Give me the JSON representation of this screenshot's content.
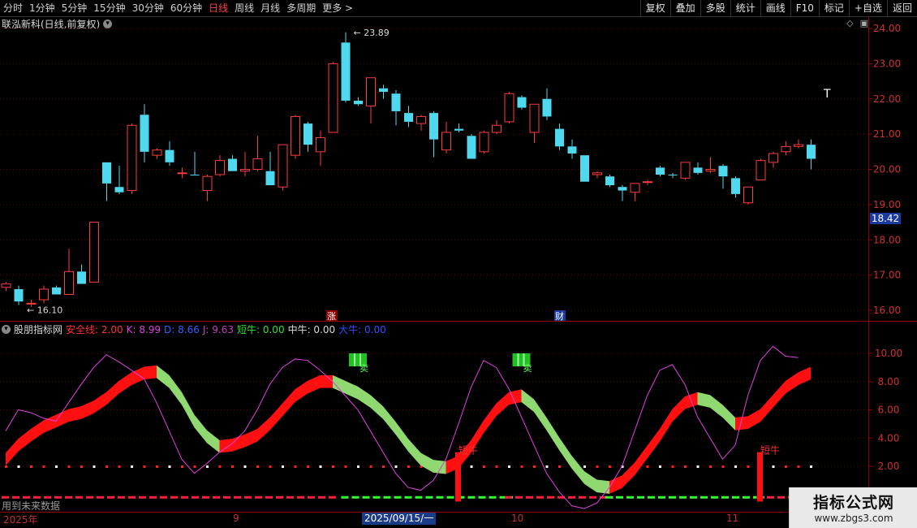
{
  "toolbar": {
    "periods": [
      "分时",
      "1分钟",
      "5分钟",
      "15分钟",
      "30分钟",
      "60分钟",
      "日线",
      "周线",
      "月线",
      "多周期",
      "更多 >"
    ],
    "active_period": "日线",
    "buttons": [
      "复权",
      "叠加",
      "多股",
      "统计",
      "画线",
      "F10",
      "标记",
      "+自选",
      "返回"
    ]
  },
  "stock": {
    "title": "联泓新科(日线,前复权)",
    "settings_icon": "chevron-down-icon",
    "high_label": "23.89",
    "low_label": "16.10",
    "current_price": "18.42",
    "markers": {
      "zhang": "涨",
      "cai": "财"
    }
  },
  "price_axis": {
    "ticks": [
      "24.00",
      "23.00",
      "22.00",
      "21.00",
      "20.00",
      "19.00",
      "18.00",
      "17.00",
      "16.00"
    ]
  },
  "indicator": {
    "name": "股朋指标网",
    "values": [
      {
        "label": "安全线:",
        "value": "2.00",
        "color": "#ff3030"
      },
      {
        "label": "K:",
        "value": "8.99",
        "color": "#e040e0"
      },
      {
        "label": "D:",
        "value": "8.66",
        "color": "#3060ff"
      },
      {
        "label": "J:",
        "value": "9.63",
        "color": "#c040c0"
      },
      {
        "label": "短牛:",
        "value": "0.00",
        "color": "#30e030"
      },
      {
        "label": "中牛:",
        "value": "0.00",
        "color": "#d8d8d8"
      },
      {
        "label": "大牛:",
        "value": "0.00",
        "color": "#3050ff"
      }
    ],
    "axis_ticks": [
      "10.00",
      "8.00",
      "6.00",
      "4.00",
      "2.00"
    ],
    "buy_label": "短牛",
    "sell_label": "卖"
  },
  "date_axis": {
    "labels": [
      "2025年",
      "9",
      "10",
      "11"
    ],
    "highlight": "2025/09/15/一"
  },
  "future_data_text": "用到未来数据",
  "watermark": {
    "title": "指标公式网",
    "url": "www.zbgs3.com"
  },
  "chart_data": {
    "type": "candlestick",
    "ylim": [
      15.8,
      24.3
    ],
    "candles": [
      {
        "o": 16.65,
        "h": 16.8,
        "l": 16.55,
        "c": 16.75,
        "up": true
      },
      {
        "o": 16.6,
        "h": 16.7,
        "l": 16.15,
        "c": 16.25,
        "up": false
      },
      {
        "o": 16.2,
        "h": 16.3,
        "l": 16.1,
        "c": 16.2,
        "up": true
      },
      {
        "o": 16.3,
        "h": 16.7,
        "l": 16.2,
        "c": 16.6,
        "up": true
      },
      {
        "o": 16.65,
        "h": 16.7,
        "l": 16.45,
        "c": 16.45,
        "up": false
      },
      {
        "o": 16.45,
        "h": 17.75,
        "l": 16.45,
        "c": 17.1,
        "up": true
      },
      {
        "o": 17.1,
        "h": 17.3,
        "l": 16.75,
        "c": 16.75,
        "up": false
      },
      {
        "o": 16.8,
        "h": 18.5,
        "l": 16.8,
        "c": 18.5,
        "up": true
      },
      {
        "o": 20.2,
        "h": 20.2,
        "l": 19.1,
        "c": 19.6,
        "up": false
      },
      {
        "o": 19.5,
        "h": 20.1,
        "l": 19.3,
        "c": 19.35,
        "up": false
      },
      {
        "o": 19.4,
        "h": 21.3,
        "l": 19.3,
        "c": 21.25,
        "up": true
      },
      {
        "o": 21.55,
        "h": 21.85,
        "l": 20.2,
        "c": 20.5,
        "up": false
      },
      {
        "o": 20.4,
        "h": 20.6,
        "l": 20.3,
        "c": 20.55,
        "up": true
      },
      {
        "o": 20.55,
        "h": 20.8,
        "l": 20.1,
        "c": 20.2,
        "up": false
      },
      {
        "o": 19.9,
        "h": 20.05,
        "l": 19.75,
        "c": 19.9,
        "up": true
      },
      {
        "o": 19.85,
        "h": 20.5,
        "l": 19.85,
        "c": 19.85,
        "up": false
      },
      {
        "o": 19.4,
        "h": 19.85,
        "l": 19.1,
        "c": 19.8,
        "up": true
      },
      {
        "o": 19.85,
        "h": 20.4,
        "l": 19.8,
        "c": 20.25,
        "up": true
      },
      {
        "o": 20.3,
        "h": 20.4,
        "l": 19.95,
        "c": 19.95,
        "up": false
      },
      {
        "o": 20.0,
        "h": 20.5,
        "l": 19.8,
        "c": 19.95,
        "up": true
      },
      {
        "o": 20.0,
        "h": 20.95,
        "l": 19.95,
        "c": 20.3,
        "up": true
      },
      {
        "o": 19.95,
        "h": 20.5,
        "l": 19.8,
        "c": 19.55,
        "up": false
      },
      {
        "o": 19.5,
        "h": 20.7,
        "l": 19.4,
        "c": 20.7,
        "up": true
      },
      {
        "o": 20.4,
        "h": 21.55,
        "l": 20.3,
        "c": 21.5,
        "up": true
      },
      {
        "o": 21.3,
        "h": 21.35,
        "l": 20.5,
        "c": 20.7,
        "up": false
      },
      {
        "o": 20.5,
        "h": 21.1,
        "l": 20.1,
        "c": 20.9,
        "up": true
      },
      {
        "o": 21.05,
        "h": 23.05,
        "l": 21.05,
        "c": 23.0,
        "up": true
      },
      {
        "o": 23.6,
        "h": 23.89,
        "l": 21.9,
        "c": 21.95,
        "up": false
      },
      {
        "o": 21.95,
        "h": 22.05,
        "l": 21.8,
        "c": 21.85,
        "up": false
      },
      {
        "o": 21.8,
        "h": 22.6,
        "l": 21.3,
        "c": 22.6,
        "up": true
      },
      {
        "o": 22.3,
        "h": 22.4,
        "l": 22.0,
        "c": 22.2,
        "up": false
      },
      {
        "o": 22.15,
        "h": 22.25,
        "l": 21.25,
        "c": 21.65,
        "up": false
      },
      {
        "o": 21.6,
        "h": 21.8,
        "l": 21.2,
        "c": 21.35,
        "up": false
      },
      {
        "o": 21.3,
        "h": 21.55,
        "l": 21.1,
        "c": 21.5,
        "up": true
      },
      {
        "o": 21.6,
        "h": 21.65,
        "l": 20.35,
        "c": 20.85,
        "up": false
      },
      {
        "o": 20.55,
        "h": 21.35,
        "l": 20.45,
        "c": 21.05,
        "up": true
      },
      {
        "o": 21.15,
        "h": 21.3,
        "l": 21.05,
        "c": 21.1,
        "up": false
      },
      {
        "o": 20.95,
        "h": 21.0,
        "l": 20.3,
        "c": 20.3,
        "up": false
      },
      {
        "o": 20.5,
        "h": 21.1,
        "l": 20.45,
        "c": 21.05,
        "up": true
      },
      {
        "o": 21.05,
        "h": 21.4,
        "l": 21.0,
        "c": 21.25,
        "up": true
      },
      {
        "o": 21.35,
        "h": 22.2,
        "l": 21.3,
        "c": 22.15,
        "up": true
      },
      {
        "o": 22.05,
        "h": 22.1,
        "l": 21.7,
        "c": 21.75,
        "up": false
      },
      {
        "o": 21.05,
        "h": 21.85,
        "l": 20.75,
        "c": 21.85,
        "up": true
      },
      {
        "o": 22.0,
        "h": 22.3,
        "l": 21.4,
        "c": 21.5,
        "up": false
      },
      {
        "o": 21.15,
        "h": 21.3,
        "l": 20.55,
        "c": 20.65,
        "up": false
      },
      {
        "o": 20.65,
        "h": 20.85,
        "l": 20.3,
        "c": 20.45,
        "up": false
      },
      {
        "o": 20.4,
        "h": 20.4,
        "l": 19.65,
        "c": 19.65,
        "up": false
      },
      {
        "o": 19.85,
        "h": 19.95,
        "l": 19.75,
        "c": 19.9,
        "up": true
      },
      {
        "o": 19.8,
        "h": 19.85,
        "l": 19.5,
        "c": 19.55,
        "up": false
      },
      {
        "o": 19.5,
        "h": 19.55,
        "l": 19.1,
        "c": 19.4,
        "up": false
      },
      {
        "o": 19.35,
        "h": 19.55,
        "l": 19.1,
        "c": 19.6,
        "up": true
      },
      {
        "o": 19.65,
        "h": 19.7,
        "l": 19.55,
        "c": 19.65,
        "up": true
      },
      {
        "o": 20.05,
        "h": 20.1,
        "l": 19.8,
        "c": 19.85,
        "up": false
      },
      {
        "o": 19.85,
        "h": 19.9,
        "l": 19.75,
        "c": 19.85,
        "up": false
      },
      {
        "o": 19.75,
        "h": 20.15,
        "l": 19.7,
        "c": 20.2,
        "up": true
      },
      {
        "o": 20.05,
        "h": 20.2,
        "l": 19.85,
        "c": 19.9,
        "up": false
      },
      {
        "o": 19.95,
        "h": 20.35,
        "l": 19.9,
        "c": 20.0,
        "up": true
      },
      {
        "o": 20.1,
        "h": 20.15,
        "l": 19.45,
        "c": 19.8,
        "up": false
      },
      {
        "o": 19.75,
        "h": 19.8,
        "l": 19.2,
        "c": 19.3,
        "up": false
      },
      {
        "o": 19.05,
        "h": 19.5,
        "l": 19.0,
        "c": 19.5,
        "up": true
      },
      {
        "o": 19.7,
        "h": 20.3,
        "l": 19.7,
        "c": 20.25,
        "up": true
      },
      {
        "o": 20.2,
        "h": 20.5,
        "l": 20.05,
        "c": 20.45,
        "up": true
      },
      {
        "o": 20.5,
        "h": 20.8,
        "l": 20.4,
        "c": 20.65,
        "up": true
      },
      {
        "o": 20.65,
        "h": 20.85,
        "l": 20.6,
        "c": 20.7,
        "up": true
      },
      {
        "o": 20.7,
        "h": 20.85,
        "l": 20.0,
        "c": 20.3,
        "up": false
      }
    ]
  }
}
